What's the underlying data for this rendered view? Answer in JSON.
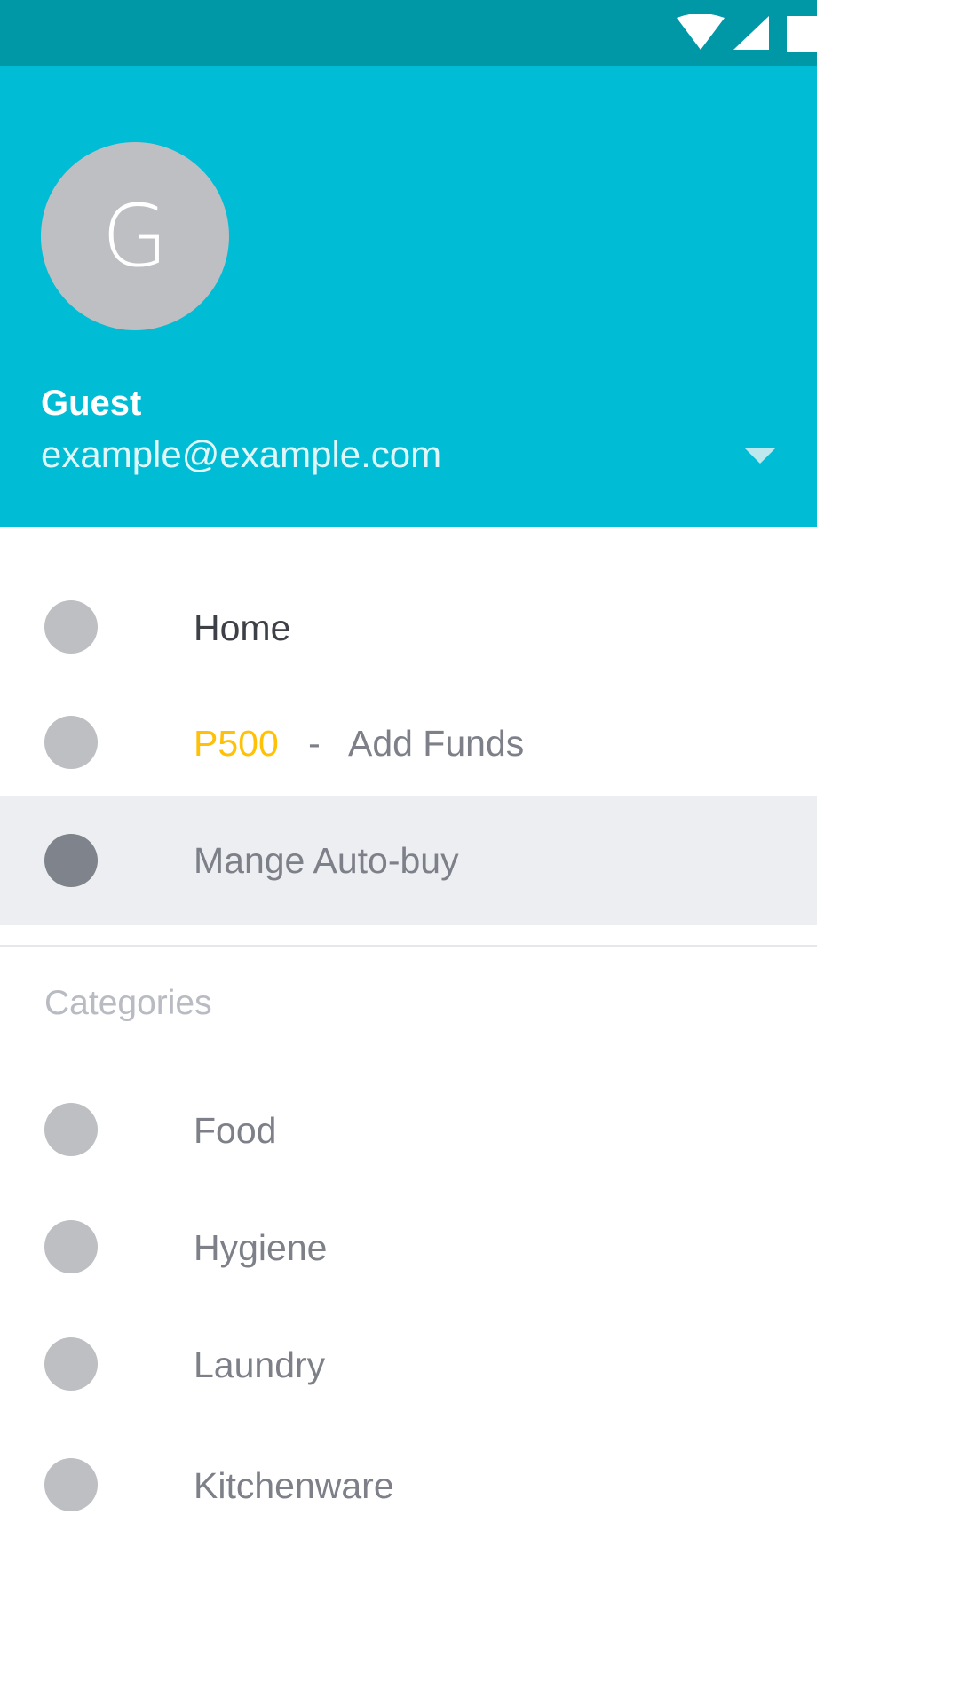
{
  "status_bar": {
    "icons": [
      "wifi-icon",
      "signal-icon",
      "battery-icon"
    ]
  },
  "account": {
    "avatar_letter": "G",
    "name": "Guest",
    "email": "example@example.com"
  },
  "menu": {
    "home_label": "Home",
    "funds_amount": "P500",
    "funds_separator": "-",
    "funds_label": "Add Funds",
    "autobuy_label": "Mange Auto-buy"
  },
  "categories": {
    "header": "Categories",
    "items": [
      {
        "label": "Food"
      },
      {
        "label": "Hygiene"
      },
      {
        "label": "Laundry"
      },
      {
        "label": "Kitchenware"
      }
    ]
  },
  "colors": {
    "status_bar": "#0097a7",
    "header": "#00bcd4",
    "funds_accent": "#ffc107",
    "selected_row": "#eceef2"
  }
}
